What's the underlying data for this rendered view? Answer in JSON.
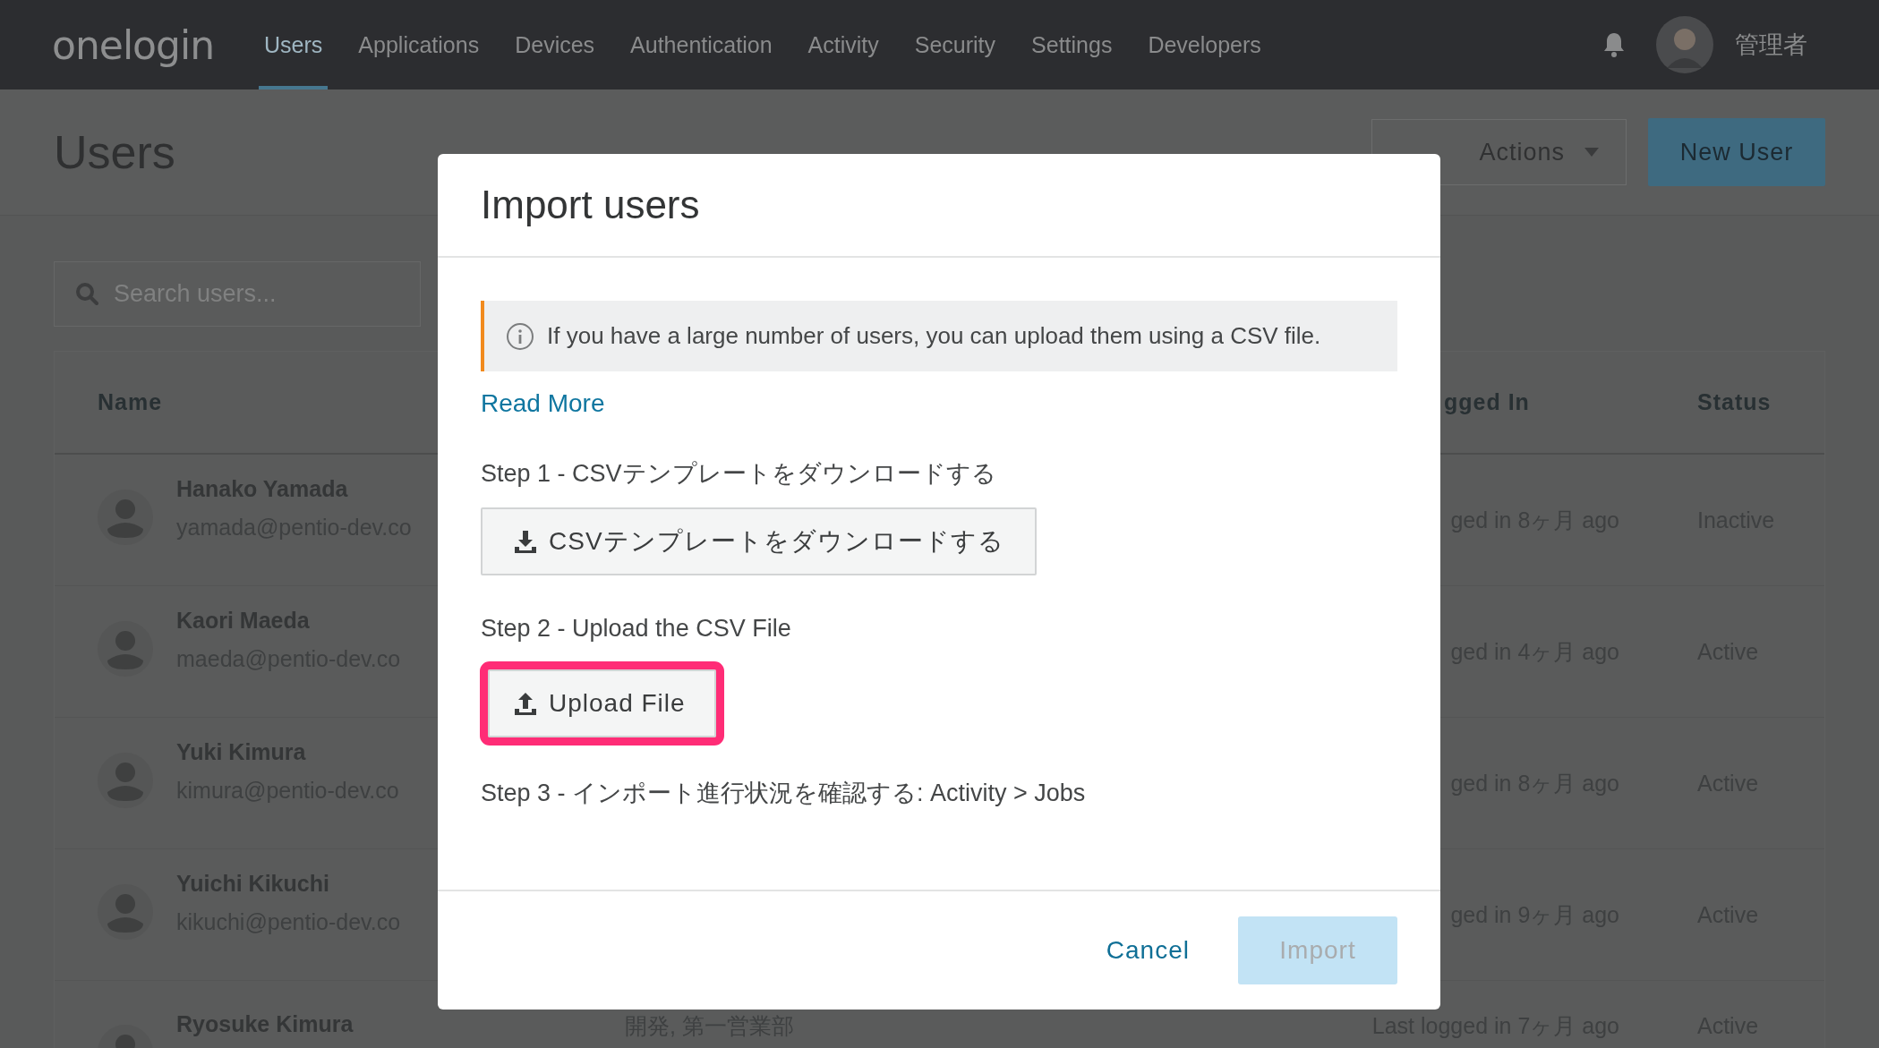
{
  "nav": {
    "logo": "onelogin",
    "items": [
      {
        "label": "Users",
        "selected": true
      },
      {
        "label": "Applications",
        "selected": false
      },
      {
        "label": "Devices",
        "selected": false
      },
      {
        "label": "Authentication",
        "selected": false
      },
      {
        "label": "Activity",
        "selected": false
      },
      {
        "label": "Security",
        "selected": false
      },
      {
        "label": "Settings",
        "selected": false
      },
      {
        "label": "Developers",
        "selected": false
      }
    ],
    "user": "管理者"
  },
  "page": {
    "title": "Users",
    "buttons": [
      {
        "label": "Actions",
        "kind": "dropdown"
      },
      {
        "label": "New User",
        "kind": "primary"
      }
    ],
    "search": {
      "placeholder": "Search users..."
    }
  },
  "table": {
    "columns": [
      "Name",
      "",
      "gged In",
      "Status"
    ],
    "rows": [
      {
        "name": "Hanako Yamada",
        "email": "yamada@pentio-dev.co",
        "last_login": "ged in 8ヶ月 ago",
        "status": "Inactive"
      },
      {
        "name": "Kaori Maeda",
        "email": "maeda@pentio-dev.co",
        "last_login": "ged in 4ヶ月 ago",
        "status": "Active"
      },
      {
        "name": "Yuki Kimura",
        "email": "kimura@pentio-dev.co",
        "last_login": "ged in 8ヶ月 ago",
        "status": "Active"
      },
      {
        "name": "Yuichi Kikuchi",
        "email": "kikuchi@pentio-dev.co",
        "last_login": "ged in 9ヶ月 ago",
        "status": "Active"
      },
      {
        "name": "Ryosuke Kimura",
        "department": "開発, 第一営業部",
        "last_login": "Last logged in 7ヶ月 ago",
        "status": "Active"
      }
    ]
  },
  "dialog": {
    "title": "Import users",
    "notice": "If you have a large number of users, you can upload them using a CSV file.",
    "link": "Read More",
    "steps": [
      {
        "label": "Step 1 - CSVテンプレートをダウンロードする",
        "button": {
          "label": "CSVテンプレートをダウンロードする",
          "kind": "download",
          "highlighted": false
        }
      },
      {
        "label": "Step 2 - Upload the CSV File",
        "button": {
          "label": "Upload File",
          "kind": "upload",
          "highlighted": true
        }
      },
      {
        "label": "Step 3 - インポート進行状況を確認する: Activity > Jobs"
      }
    ],
    "actions": [
      {
        "label": "Cancel",
        "kind": "text",
        "disabled": false
      },
      {
        "label": "Import",
        "kind": "primary",
        "disabled": true
      }
    ]
  }
}
